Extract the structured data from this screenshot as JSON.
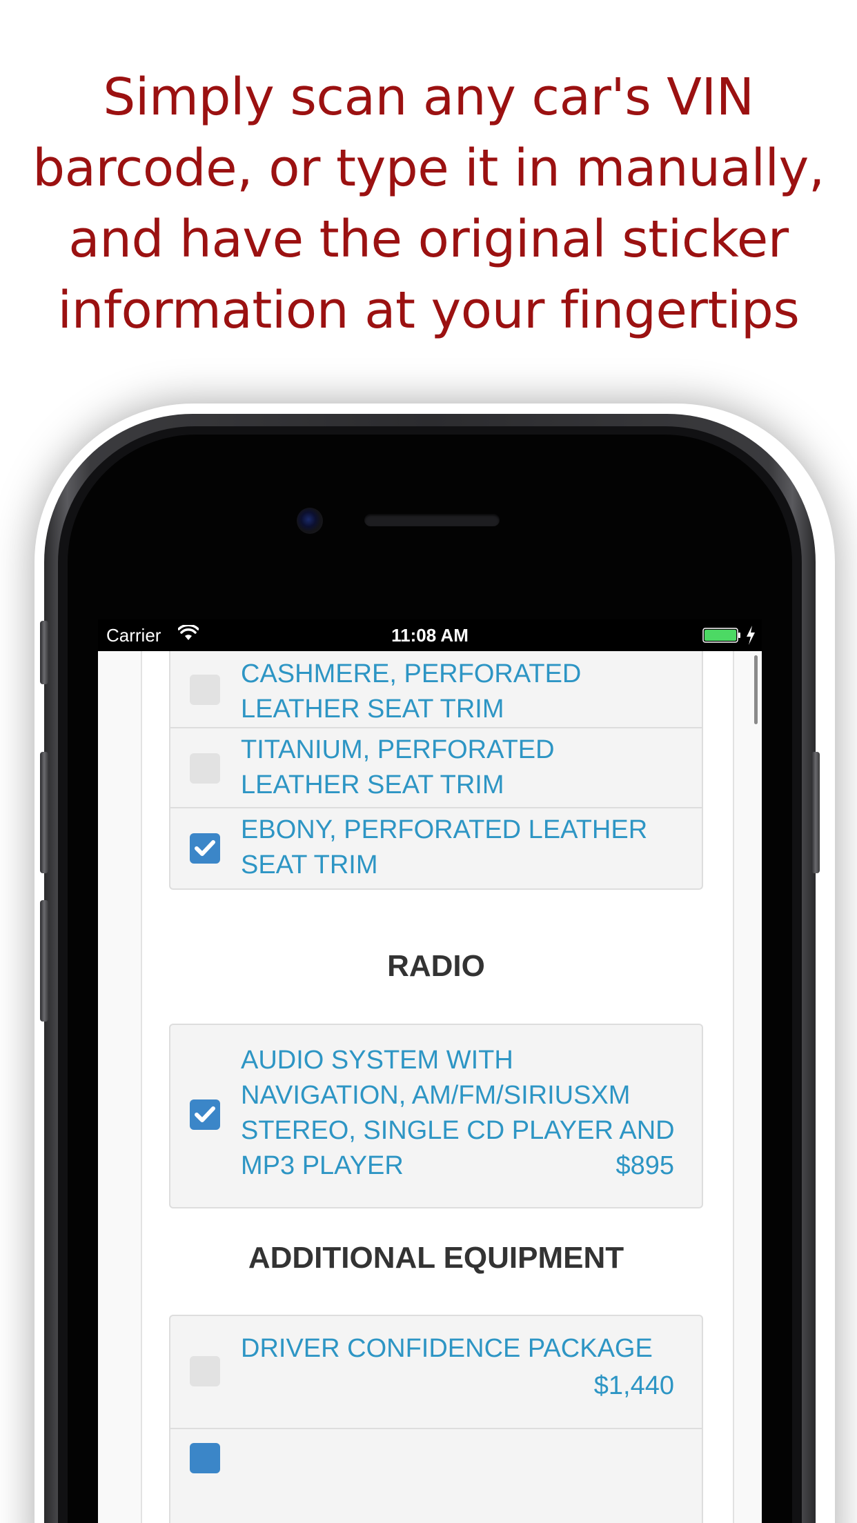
{
  "promo": {
    "line1": "Simply scan any car's VIN",
    "line2": "barcode, or type it in manually,",
    "line3": "and have the original sticker",
    "line4": "information at your fingertips",
    "color": "#9b1111"
  },
  "statusbar": {
    "carrier": "Carrier",
    "time": "11:08 AM",
    "wifi_icon": "wifi-icon",
    "battery_icon": "battery-charging-icon",
    "battery_color": "#4cd964"
  },
  "interior": {
    "options": [
      {
        "label_line1": "CASHMERE, PERFORATED",
        "label_line2": "LEATHER SEAT TRIM",
        "checked": false
      },
      {
        "label_line1": "TITANIUM, PERFORATED",
        "label_line2": "LEATHER SEAT TRIM",
        "checked": false
      },
      {
        "label_line1": "EBONY, PERFORATED LEATHER",
        "label_line2": "SEAT TRIM",
        "checked": true
      }
    ]
  },
  "radio": {
    "title": "RADIO",
    "options": [
      {
        "label_line1": "AUDIO SYSTEM WITH",
        "label_line2": "NAVIGATION, AM/FM/SIRIUSXM",
        "label_line3": "STEREO, SINGLE CD PLAYER AND",
        "label_line4": "MP3 PLAYER",
        "price": "$895",
        "checked": true
      }
    ]
  },
  "additional_equipment": {
    "title": "ADDITIONAL EQUIPMENT",
    "options": [
      {
        "label": "DRIVER CONFIDENCE PACKAGE",
        "price": "$1,440",
        "checked": false
      }
    ]
  },
  "colors": {
    "link_blue": "#2d95c4",
    "checkbox_checked": "#3b86c8",
    "heading": "#333333"
  }
}
